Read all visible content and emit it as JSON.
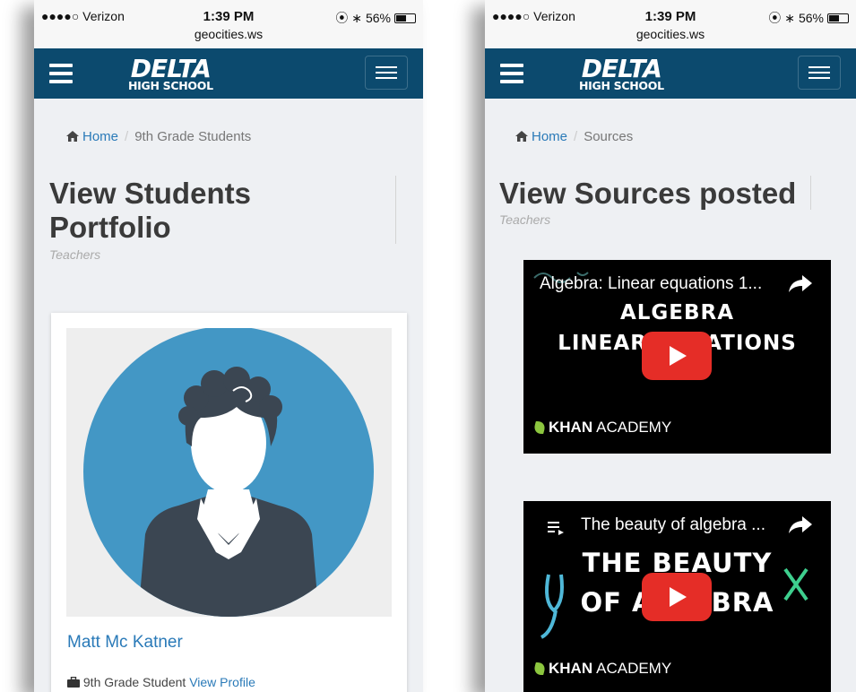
{
  "status": {
    "carrier": "●●●●○ Verizon",
    "time": "1:39 PM",
    "url": "geocities.ws",
    "battery": "56%"
  },
  "brand": {
    "line1": "DELTA",
    "line2": "HIGH SCHOOL",
    "nav_color": "#0c4a6e"
  },
  "left": {
    "breadcrumb": {
      "home": "Home",
      "current": "9th Grade Students"
    },
    "title_line1": "View Students",
    "title_line2": "Portfolio",
    "subtitle": "Teachers",
    "student": {
      "name": "Matt Mc Katner",
      "role": "9th Grade Student",
      "link": "View Profile"
    }
  },
  "right": {
    "breadcrumb": {
      "home": "Home",
      "current": "Sources"
    },
    "title": "View Sources posted",
    "subtitle": "Teachers",
    "videos": [
      {
        "title": "Algebra: Linear equations 1...",
        "big1": "ALGEBRA",
        "big2": "LINEAR EQUATIONS",
        "brand_bold": "KHAN",
        "brand_rest": "ACADEMY"
      },
      {
        "title": "The beauty of algebra ...",
        "big1": "THE BEAUTY",
        "big2": "OF ALGEBRA",
        "brand_bold": "KHAN",
        "brand_rest": "ACADEMY"
      }
    ]
  },
  "icons": [
    "menu-icon",
    "navbar-toggle-icon",
    "home-icon",
    "briefcase-icon",
    "share-icon",
    "playlist-icon",
    "play-icon",
    "avatar-icon"
  ]
}
